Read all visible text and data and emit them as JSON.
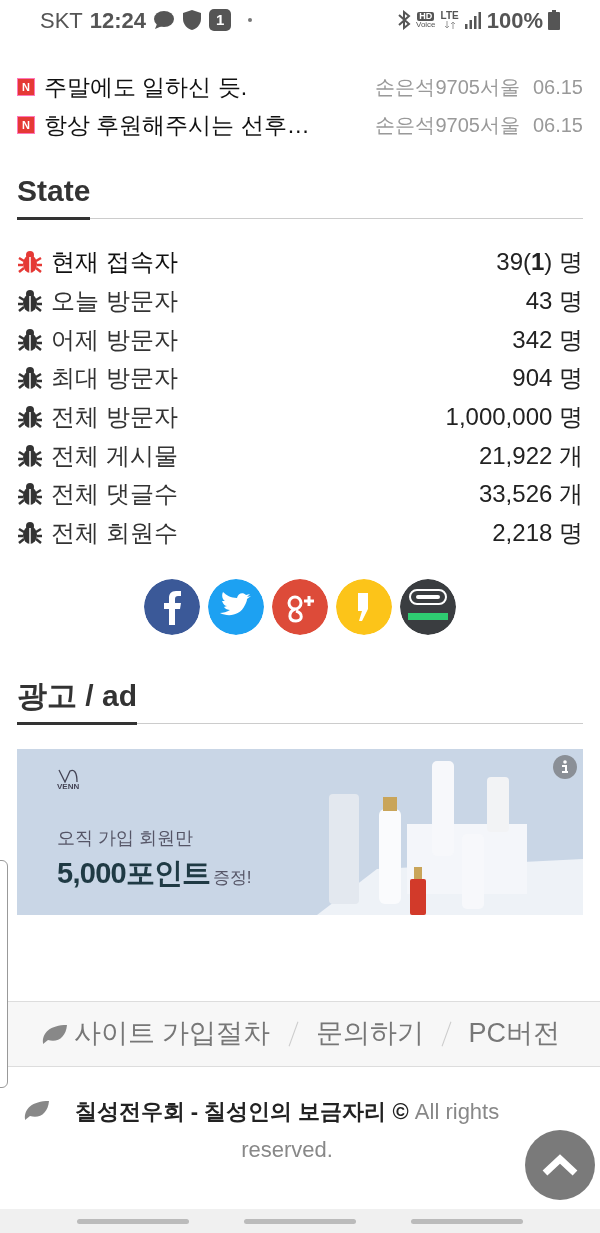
{
  "status_bar": {
    "carrier": "SKT",
    "time": "12:24",
    "notification_count": "1",
    "hd_label": "HD",
    "voice_label": "Voice",
    "network": "LTE",
    "battery": "100%"
  },
  "recent_posts": [
    {
      "badge": "N",
      "title": "주말에도 일하신 듯.",
      "author": "손은석9705서울",
      "date": "06.15"
    },
    {
      "badge": "N",
      "title": "항상 후원해주시는 선후…",
      "author": "손은석9705서울",
      "date": "06.15"
    }
  ],
  "state": {
    "title": "State",
    "items": [
      {
        "label": "현재 접속자",
        "value": "39(**1**) 명",
        "active": true
      },
      {
        "label": "오늘 방문자",
        "value": "43 명",
        "active": false
      },
      {
        "label": "어제 방문자",
        "value": "342 명",
        "active": false
      },
      {
        "label": "최대 방문자",
        "value": "904 명",
        "active": false
      },
      {
        "label": "전체 방문자",
        "value": "1,000,000 명",
        "active": false
      },
      {
        "label": "전체 게시물",
        "value": "21,922 개",
        "active": false
      },
      {
        "label": "전체 댓글수",
        "value": "33,526 개",
        "active": false
      },
      {
        "label": "전체 회원수",
        "value": "2,218 명",
        "active": false
      }
    ]
  },
  "share_buttons": [
    {
      "kind": "facebook",
      "color": "#3b5998"
    },
    {
      "kind": "twitter",
      "color": "#1da1f2"
    },
    {
      "kind": "google",
      "color": "#dd4b39"
    },
    {
      "kind": "kakaostory",
      "color": "#fcc419"
    },
    {
      "kind": "band",
      "color": "#3a3d40"
    }
  ],
  "ad": {
    "title": "광고 / ad",
    "brand": "VENN",
    "line1": "오직 가입 회원만",
    "highlight": "5,000포인트",
    "suffix": "증정!"
  },
  "footer_links": [
    "사이트 가입절차",
    "문의하기",
    "PC버전"
  ],
  "copyright": {
    "site": "칠성전우회 - 칠성인의 보금자리 ©",
    "rest": "All rights reserved."
  }
}
